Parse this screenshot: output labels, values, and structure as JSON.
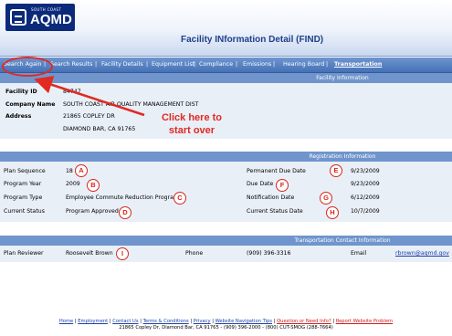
{
  "header": {
    "logo_sub": "SOUTH COAST",
    "logo_main": "AQMD",
    "title": "Facility INformation Detail (FIND)"
  },
  "nav": {
    "items": [
      "Search Again",
      "Search Results",
      "Facility Details",
      "Equipment List",
      "Compliance",
      "Emissions",
      "Hearing Board",
      "Transportation"
    ],
    "separator": "|",
    "active": "Transportation"
  },
  "facility": {
    "section_title": "Facility Information",
    "id_label": "Facility ID",
    "id_value": "84747",
    "company_label": "Company Name",
    "company_value": "SOUTH COAST AIR QUALITY MANAGEMENT DIST",
    "address_label": "Address",
    "address_line1": "21865 COPLEY DR",
    "address_line2": "DIAMOND BAR, CA 91765"
  },
  "registration": {
    "section_title": "Registration Information",
    "plan_sequence_label": "Plan Sequence",
    "plan_sequence_value": "18",
    "program_year_label": "Program Year",
    "program_year_value": "2009",
    "program_type_label": "Program Type",
    "program_type_value": "Employee Commute Reduction Program",
    "current_status_label": "Current Status",
    "current_status_value": "Program Approved",
    "permanent_due_label": "Permanent Due Date",
    "permanent_due_value": "9/23/2009",
    "due_date_label": "Due Date",
    "due_date_value": "9/23/2009",
    "notification_label": "Notification Date",
    "notification_value": "6/12/2009",
    "status_date_label": "Current Status Date",
    "status_date_value": "10/7/2009"
  },
  "contact": {
    "section_title": "Transportation Contact Information",
    "reviewer_label": "Plan Reviewer",
    "reviewer_value": "Roosevelt Brown",
    "phone_label": "Phone",
    "phone_value": "(909) 396-3316",
    "email_label": "Email",
    "email_value": "rbrown@aqmd.gov"
  },
  "badges": [
    "A",
    "B",
    "C",
    "D",
    "E",
    "F",
    "G",
    "H",
    "I"
  ],
  "callout": {
    "line1": "Click here to",
    "line2": "start over"
  },
  "footer": {
    "links": [
      "Home",
      "Employment",
      "Contact Us",
      "Terms & Conditions",
      "Privacy",
      "Website Navigation Tips",
      "Question or Need Info?",
      "Report Website Problem"
    ],
    "address": "21865 Copley Dr, Diamond Bar, CA 91765 - (909) 396-2000 - (800) CUT-SMOG (288-7664)"
  },
  "colors": {
    "nav_blue": "#4571b6",
    "section_blue": "#6f95cc",
    "panel_bg": "#e9eff7",
    "accent_red": "#e02a22",
    "link_blue": "#1b3fa8"
  }
}
